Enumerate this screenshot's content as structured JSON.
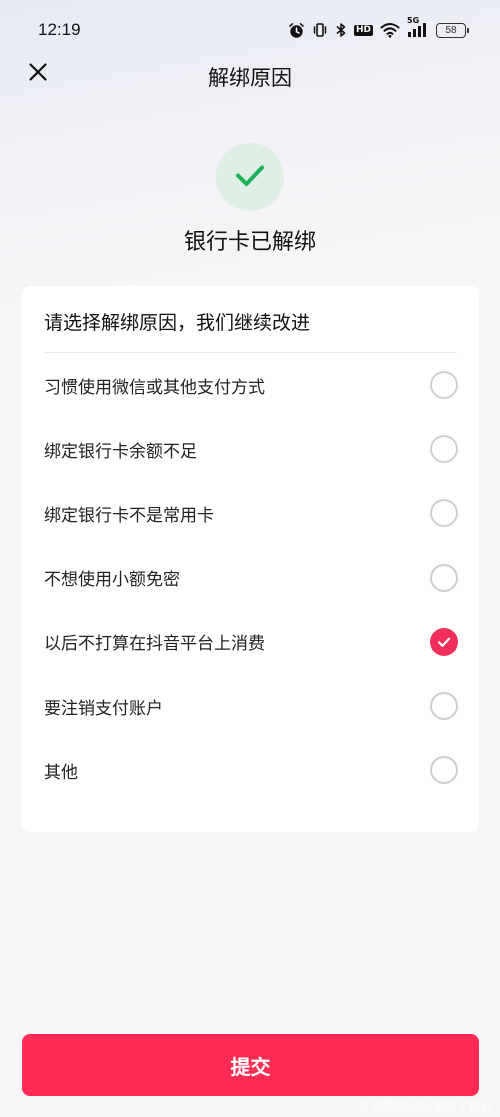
{
  "status_bar": {
    "time": "12:19",
    "network_label": "5G",
    "hd_label": "HD",
    "battery": "58"
  },
  "nav": {
    "title": "解绑原因"
  },
  "result": {
    "text": "银行卡已解绑",
    "icon": "checkmark-icon",
    "color": "#1fb15a"
  },
  "reasons": {
    "title": "请选择解绑原因，我们继续改进",
    "options": [
      {
        "label": "习惯使用微信或其他支付方式",
        "selected": false
      },
      {
        "label": "绑定银行卡余额不足",
        "selected": false
      },
      {
        "label": "绑定银行卡不是常用卡",
        "selected": false
      },
      {
        "label": "不想使用小额免密",
        "selected": false
      },
      {
        "label": "以后不打算在抖音平台上消费",
        "selected": true
      },
      {
        "label": "要注销支付账户",
        "selected": false
      },
      {
        "label": "其他",
        "selected": false
      }
    ]
  },
  "submit": {
    "label": "提交",
    "color": "#fe2c55"
  },
  "watermark": {
    "text": "@眼泪闪闪变成了钻石"
  }
}
